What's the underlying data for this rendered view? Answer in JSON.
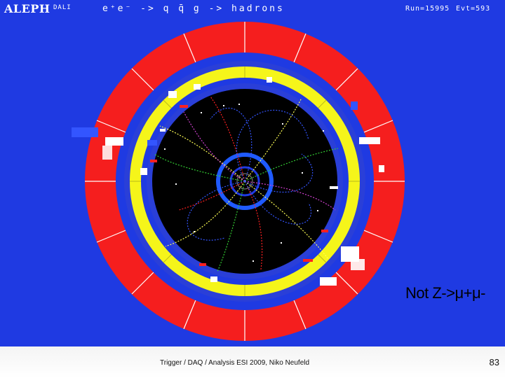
{
  "header": {
    "logo": "ALEPH",
    "daliver": "DALI",
    "process": "e⁺e⁻ -> q q̄ g -> hadrons",
    "run": "Run=15995",
    "event": "Evt=593"
  },
  "caption": "Not Z->μ+μ-",
  "footer": {
    "text": "Trigger / DAQ / Analysis ESI 2009, Niko Neufeld",
    "page_number": "83"
  },
  "colors": {
    "background_blue": "#1f3ae2",
    "calorimeter_red": "#f51e1e",
    "ecal_yellow": "#f5f51a",
    "tracker_black": "#000000",
    "track_yellow": "#ffff55",
    "track_green": "#33cc33",
    "track_red": "#ff2020",
    "track_blue": "#3355ff",
    "track_magenta": "#d040d0",
    "hits_white": "#ffffff"
  }
}
